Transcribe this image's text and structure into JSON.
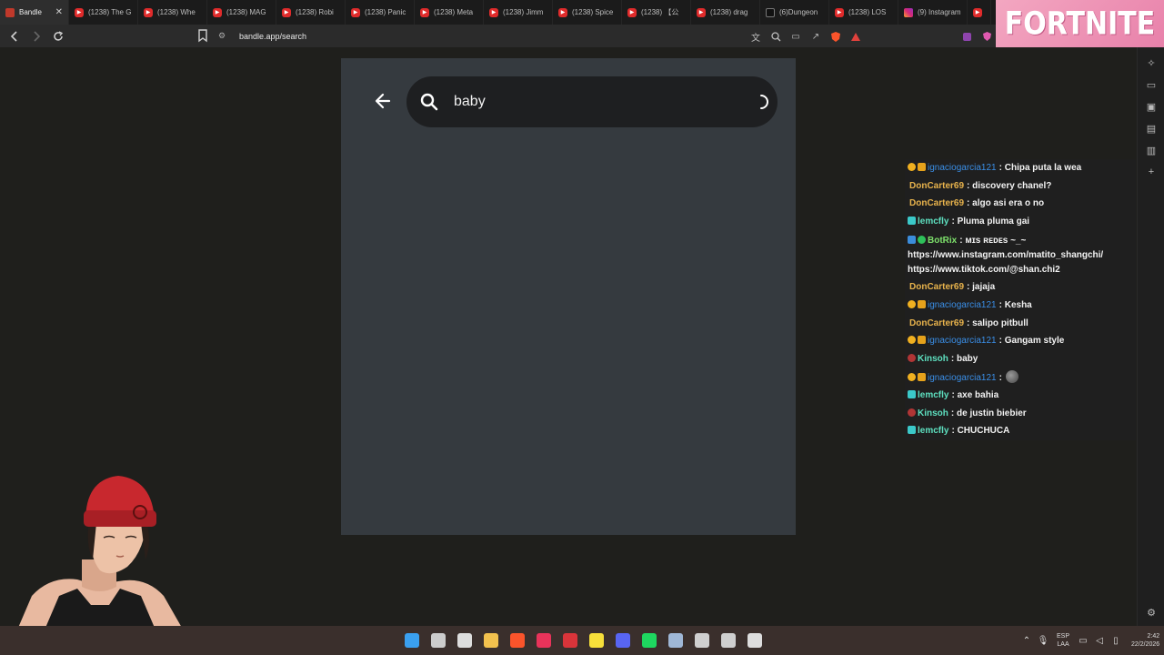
{
  "browser": {
    "tabs": [
      {
        "title": "Bandle",
        "favicon": "bandle-icon",
        "active": true
      },
      {
        "title": "(1238) The G",
        "favicon": "youtube-icon"
      },
      {
        "title": "(1238) Whe",
        "favicon": "youtube-icon"
      },
      {
        "title": "(1238) MAG",
        "favicon": "youtube-icon"
      },
      {
        "title": "(1238) Robi",
        "favicon": "youtube-icon"
      },
      {
        "title": "(1238) Panic",
        "favicon": "youtube-icon"
      },
      {
        "title": "(1238) Meta",
        "favicon": "youtube-icon"
      },
      {
        "title": "(1238) Jimm",
        "favicon": "youtube-icon"
      },
      {
        "title": "(1238) Spice",
        "favicon": "youtube-icon"
      },
      {
        "title": "(1238) 【公",
        "favicon": "youtube-icon"
      },
      {
        "title": "(1238) drag",
        "favicon": "youtube-icon"
      },
      {
        "title": "(6)Dungeon",
        "favicon": "tiktok-icon"
      },
      {
        "title": "(1238) LOS",
        "favicon": "youtube-icon"
      },
      {
        "title": "(9) Instagram",
        "favicon": "instagram-icon"
      },
      {
        "title": "",
        "favicon": "youtube-icon"
      }
    ],
    "close_glyph": "✕",
    "url": "bandle.app/search"
  },
  "overlay": {
    "fortnite_text": "FORTNITE"
  },
  "search": {
    "query": "baby"
  },
  "chat": [
    {
      "badges": [
        "b-warn",
        "b-sub"
      ],
      "user": "ignaciogarcia121",
      "ucls": "u-blue",
      "text": ": Chipa puta la wea"
    },
    {
      "badges": [],
      "user": "DonCarter69",
      "ucls": "u-orange",
      "text": ": discovery chanel?"
    },
    {
      "badges": [],
      "user": "DonCarter69",
      "ucls": "u-orange",
      "text": ": algo asi era o no"
    },
    {
      "badges": [
        "b-tv"
      ],
      "user": "lemcfly",
      "ucls": "u-teal",
      "text": ": Pluma pluma gai"
    },
    {
      "badges": [
        "b-bot",
        "b-ok"
      ],
      "user": "BotRix",
      "ucls": "u-green",
      "text": ": ᴍɪs ʀᴇᴅᴇs ~_~ https://www.instagram.com/matito_shangchi/ https://www.tiktok.com/@shan.chi2"
    },
    {
      "badges": [],
      "user": "DonCarter69",
      "ucls": "u-orange",
      "text": ": jajaja"
    },
    {
      "badges": [
        "b-warn",
        "b-sub"
      ],
      "user": "ignaciogarcia121",
      "ucls": "u-blue",
      "text": ": Kesha"
    },
    {
      "badges": [],
      "user": "DonCarter69",
      "ucls": "u-orange",
      "text": ": salipo pitbull"
    },
    {
      "badges": [
        "b-warn",
        "b-sub"
      ],
      "user": "ignaciogarcia121",
      "ucls": "u-blue",
      "text": ": Gangam style"
    },
    {
      "badges": [
        "b-red"
      ],
      "user": "Kinsoh",
      "ucls": "u-teal",
      "text": ": baby"
    },
    {
      "badges": [
        "b-warn",
        "b-sub"
      ],
      "user": "ignaciogarcia121",
      "ucls": "u-blue",
      "text": ":",
      "emote": true
    },
    {
      "badges": [
        "b-tv"
      ],
      "user": "lemcfly",
      "ucls": "u-teal",
      "text": ": axe bahia"
    },
    {
      "badges": [
        "b-red"
      ],
      "user": "Kinsoh",
      "ucls": "u-teal",
      "text": ": de justin biebier"
    },
    {
      "badges": [
        "b-tv"
      ],
      "user": "lemcfly",
      "ucls": "u-teal",
      "text": ": CHUCHUCA"
    }
  ],
  "taskbar": {
    "lang_line1": "ESP",
    "lang_line2": "LAA",
    "time": "2:42",
    "date": "22/2/2026",
    "apps": [
      {
        "name": "windows-start-icon",
        "color": "#3aa0f0"
      },
      {
        "name": "search-icon",
        "color": "#cccccc"
      },
      {
        "name": "task-view-icon",
        "color": "#dddddd"
      },
      {
        "name": "file-explorer-icon",
        "color": "#f2c14e"
      },
      {
        "name": "brave-browser-icon",
        "color": "#fb542b"
      },
      {
        "name": "media-player-icon",
        "color": "#e8335a"
      },
      {
        "name": "app-red-icon",
        "color": "#d9343a"
      },
      {
        "name": "sticky-notes-icon",
        "color": "#f7df3a"
      },
      {
        "name": "discord-icon",
        "color": "#5865f2"
      },
      {
        "name": "spotify-icon",
        "color": "#1ed760"
      },
      {
        "name": "steam-icon",
        "color": "#9fb7d6"
      },
      {
        "name": "obs-icon",
        "color": "#cfcfcf"
      },
      {
        "name": "valorant-icon",
        "color": "#cfcfcf"
      },
      {
        "name": "epic-games-icon",
        "color": "#dddddd"
      }
    ]
  }
}
